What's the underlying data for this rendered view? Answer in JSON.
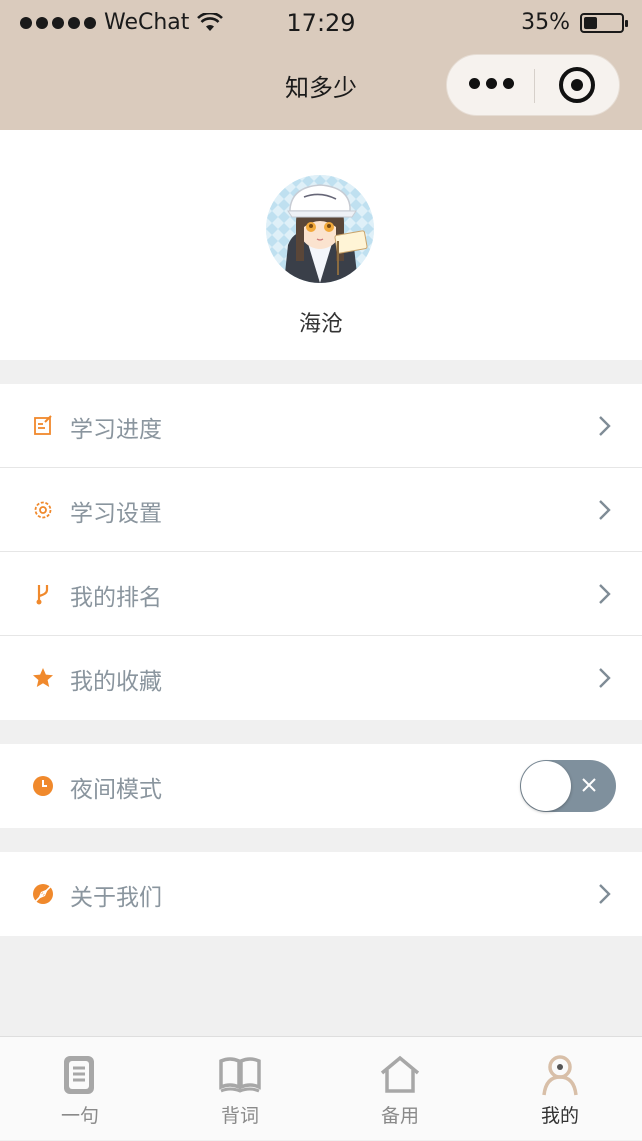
{
  "status_bar": {
    "carrier": "WeChat",
    "time": "17:29",
    "battery": "35%",
    "battery_level": 0.35
  },
  "nav": {
    "title": "知多少",
    "more_icon": "more-dots-icon",
    "close_icon": "target-circle-icon"
  },
  "profile": {
    "username": "海沧",
    "avatar_icon": "avatar-image"
  },
  "menu": [
    {
      "label": "学习进度",
      "icon": "edit-note-icon"
    },
    {
      "label": "学习设置",
      "icon": "gear-icon"
    },
    {
      "label": "我的排名",
      "icon": "branch-icon"
    },
    {
      "label": "我的收藏",
      "icon": "star-icon"
    }
  ],
  "night_mode": {
    "label": "夜间模式",
    "icon": "clock-icon",
    "enabled": false
  },
  "about": {
    "label": "关于我们",
    "icon": "compass-icon"
  },
  "tabs": [
    {
      "label": "一句",
      "icon": "document-icon",
      "active": false
    },
    {
      "label": "背词",
      "icon": "book-icon",
      "active": false
    },
    {
      "label": "备用",
      "icon": "home-icon",
      "active": false
    },
    {
      "label": "我的",
      "icon": "person-icon",
      "active": true
    }
  ],
  "colors": {
    "accent": "#f0892c",
    "header_bg": "#dacbbd",
    "label": "#8a959e",
    "toggle_off": "#7f909d"
  }
}
